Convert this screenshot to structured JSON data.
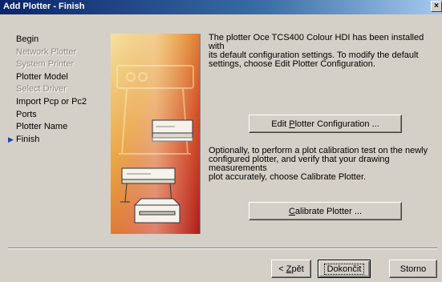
{
  "window": {
    "title": "Add Plotter - Finish",
    "close_glyph": "×"
  },
  "steps": [
    {
      "label": "Begin",
      "enabled": true,
      "current": false
    },
    {
      "label": "Network Plotter",
      "enabled": false,
      "current": false
    },
    {
      "label": "System Printer",
      "enabled": false,
      "current": false
    },
    {
      "label": "Plotter Model",
      "enabled": true,
      "current": false
    },
    {
      "label": "Select Driver",
      "enabled": false,
      "current": false
    },
    {
      "label": "Import Pcp or Pc2",
      "enabled": true,
      "current": false
    },
    {
      "label": "Ports",
      "enabled": true,
      "current": false
    },
    {
      "label": "Plotter Name",
      "enabled": true,
      "current": false
    },
    {
      "label": "Finish",
      "enabled": true,
      "current": true
    }
  ],
  "current_step_marker": "▶",
  "side_image": {
    "icon": "plotter-illustration",
    "accent_colors": [
      "#c8281e",
      "#e8a03c",
      "#f4e4a0"
    ]
  },
  "content": {
    "para1_lines": [
      "The plotter Oce TCS400 Colour HDI has been installed with",
      "its default configuration settings.  To modify the default",
      "settings, choose Edit Plotter Configuration."
    ],
    "edit_button": {
      "pre": "Edit ",
      "accel": "P",
      "post": "lotter Configuration ..."
    },
    "para2_lines": [
      "Optionally, to perform a plot calibration test on the newly",
      "configured plotter, and verify that your drawing measurements",
      "plot accurately, choose Calibrate Plotter."
    ],
    "calibrate_button": {
      "pre": "",
      "accel": "C",
      "post": "alibrate Plotter ..."
    }
  },
  "footer": {
    "back_button": {
      "pre": "< ",
      "accel": "Z",
      "post": "pět"
    },
    "finish_button": {
      "label": "Dokončit"
    },
    "cancel_button": {
      "label": "Storno"
    }
  }
}
